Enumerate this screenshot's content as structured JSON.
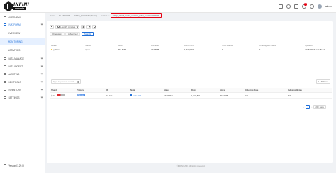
{
  "brand": {
    "name": "INFINI",
    "sub": "console"
  },
  "header": {
    "notification_count": "1",
    "user_name": "admin"
  },
  "sidebar": {
    "items": [
      {
        "label": "OVERVIEW"
      },
      {
        "label": "PLATFORM"
      },
      {
        "label": "OVERVIEW"
      },
      {
        "label": "MONITORING"
      },
      {
        "label": "ACTIVITIES"
      },
      {
        "label": "DATA MANAGE"
      },
      {
        "label": "DATA INGEST"
      },
      {
        "label": "ALERTING"
      },
      {
        "label": "DEV TOOLS"
      },
      {
        "label": "INVENTORY"
      },
      {
        "label": "SETTINGS"
      }
    ],
    "collapse_label": "Version (1.29.0)"
  },
  "breadcrumb": {
    "items": [
      "Home",
      "PLATFORM",
      "INFINI_SYSTEM (Alerts)",
      "Indices",
      "rollup_shard_node_metrics_infini_metrics-00000?"
    ]
  },
  "toolbar": {
    "time_range": "Last 15 minutes"
  },
  "tabs": [
    {
      "label": "Overview"
    },
    {
      "label": "Advanced"
    },
    {
      "label": "Shards"
    }
  ],
  "stats": [
    {
      "label": "Health",
      "value": "yellow"
    },
    {
      "label": "Status",
      "value": "open"
    },
    {
      "label": "Store",
      "value": "794.6MB"
    },
    {
      "label": "Primaries",
      "value": "794.6MB"
    },
    {
      "label": "Documents",
      "value": "1,623,591"
    },
    {
      "label": "Total shards",
      "value": "1"
    },
    {
      "label": "Unassigned shards",
      "value": "1"
    },
    {
      "label": "Updated",
      "value": "2025-09-29 10:15:14"
    }
  ],
  "search": {
    "placeholder": "Type keyword to search"
  },
  "refresh_label": "Refresh",
  "table": {
    "headers": [
      "Shard",
      "Primary",
      "IP",
      "Node",
      "State",
      "Docs",
      "Store",
      "Indexing Rate",
      "Indexing Bytes"
    ],
    "rows": [
      {
        "shard": "0",
        "primary": "Primary",
        "ip": "10.0.0.1",
        "node": "node-120",
        "state": "STARTED",
        "docs": "1,623,591",
        "store": "794.6MB",
        "indexing_rate": "0.0",
        "indexing_bytes": "N/A"
      }
    ]
  },
  "pagination": {
    "current_page": "1",
    "page_size": "20 / page"
  },
  "footer": {
    "copyright": "©INFINI LTD, All rights reserved."
  }
}
